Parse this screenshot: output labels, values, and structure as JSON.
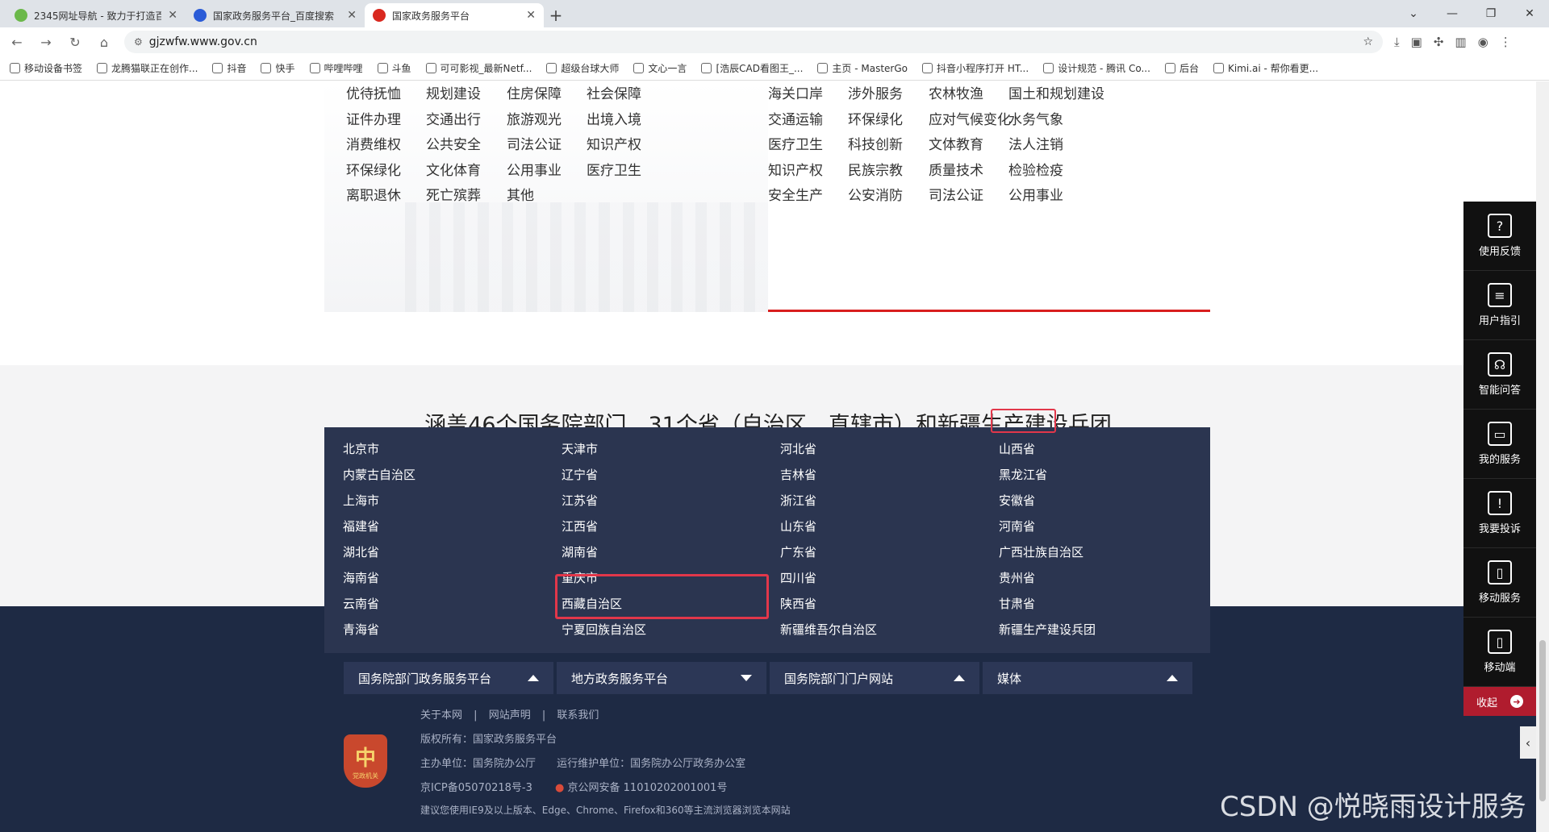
{
  "browser": {
    "tabs": [
      {
        "label": "2345网址导航 - 致力于打造百",
        "fav_color": "#6bb84a"
      },
      {
        "label": "国家政务服务平台_百度搜索",
        "fav_color": "#2a5bd7"
      },
      {
        "label": "国家政务服务平台",
        "fav_color": "#d9281f",
        "active": true
      }
    ],
    "new_tab": "+",
    "url": "gjzwfw.www.gov.cn",
    "bookmarks": [
      "移动设备书签",
      "龙腾猫联正在创作...",
      "抖音",
      "快手",
      "哔哩哔哩",
      "斗鱼",
      "可可影视_最新Netf...",
      "超级台球大师",
      "文心一言",
      "[浩辰CAD看图王_...",
      "主页 - MasterGo",
      "抖音小程序打开 HT...",
      "设计规范 - 腾讯 Co...",
      "后台",
      "Kimi.ai - 帮你看更..."
    ]
  },
  "services": {
    "left": [
      [
        "优待抚恤",
        "规划建设",
        "住房保障",
        "社会保障"
      ],
      [
        "证件办理",
        "交通出行",
        "旅游观光",
        "出境入境"
      ],
      [
        "消费维权",
        "公共安全",
        "司法公证",
        "知识产权"
      ],
      [
        "环保绿化",
        "文化体育",
        "公用事业",
        "医疗卫生"
      ],
      [
        "离职退休",
        "死亡殡葬",
        "其他"
      ]
    ],
    "right": [
      [
        "海关口岸",
        "涉外服务",
        "农林牧渔",
        "国土和规划建设"
      ],
      [
        "交通运输",
        "环保绿化",
        "应对气候变化",
        "水务气象"
      ],
      [
        "医疗卫生",
        "科技创新",
        "文体教育",
        "法人注销"
      ],
      [
        "知识产权",
        "民族宗教",
        "质量技术",
        "检验检疫"
      ],
      [
        "安全生产",
        "公安消防",
        "司法公证",
        "公用事业"
      ]
    ]
  },
  "coverage_title": "涵盖46个国务院部门、31个省（自治区、直辖市）和新疆生产建设兵团",
  "regions": [
    [
      "北京市",
      "天津市",
      "河北省",
      "山西省"
    ],
    [
      "内蒙古自治区",
      "辽宁省",
      "吉林省",
      "黑龙江省"
    ],
    [
      "上海市",
      "江苏省",
      "浙江省",
      "安徽省"
    ],
    [
      "福建省",
      "江西省",
      "山东省",
      "河南省"
    ],
    [
      "湖北省",
      "湖南省",
      "广东省",
      "广西壮族自治区"
    ],
    [
      "海南省",
      "重庆市",
      "四川省",
      "贵州省"
    ],
    [
      "云南省",
      "西藏自治区",
      "陕西省",
      "甘肃省"
    ],
    [
      "青海省",
      "宁夏回族自治区",
      "新疆维吾尔自治区",
      "新疆生产建设兵团"
    ]
  ],
  "footer_tabs": [
    {
      "label": "国务院部门政务服务平台",
      "open": false
    },
    {
      "label": "地方政务服务平台",
      "open": true
    },
    {
      "label": "国务院部门门户网站",
      "open": false
    },
    {
      "label": "媒体",
      "open": false
    }
  ],
  "footer": {
    "links": [
      "关于本网",
      "网站声明",
      "联系我们"
    ],
    "separator": "|",
    "copyright": "版权所有：国家政务服务平台",
    "host": "主办单位：国务院办公厅",
    "operator": "运行维护单位：国务院办公厅政务办公室",
    "icp": "京ICP备05070218号-3",
    "police": "京公网安备 11010202001001号",
    "browser_tip": "建议您使用IE9及以上版本、Edge、Chrome、Firefox和360等主流浏览器浏览本网站",
    "emblem_text": "党政机关"
  },
  "float_bar": [
    {
      "label": "使用反馈",
      "icon": "?"
    },
    {
      "label": "用户指引",
      "icon": "≡"
    },
    {
      "label": "智能问答",
      "icon": "☊"
    },
    {
      "label": "我的服务",
      "icon": "▭"
    },
    {
      "label": "我要投诉",
      "icon": "!"
    },
    {
      "label": "移动服务",
      "icon": "▯"
    },
    {
      "label": "移动端",
      "icon": "▯"
    }
  ],
  "collapse_label": "收起",
  "watermark": "CSDN @悦晓雨设计服务"
}
